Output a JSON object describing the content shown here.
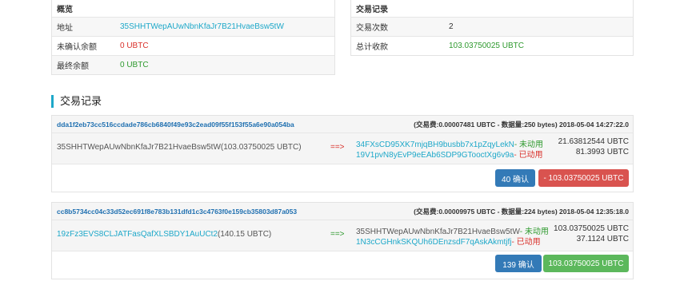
{
  "overview": {
    "title": "概览",
    "rows": [
      {
        "label": "地址",
        "value": "35SHHTWepAUwNbnKfaJr7B21HvaeBsw5tW"
      },
      {
        "label": "未确认余额",
        "value": "0 UBTC"
      },
      {
        "label": "最终余额",
        "value": "0 UBTC"
      }
    ]
  },
  "summary": {
    "title": "交易记录",
    "rows": [
      {
        "label": "交易次数",
        "value": "2"
      },
      {
        "label": "总计收款",
        "value": "103.03750025 UBTC"
      }
    ]
  },
  "section_title": "交易记录",
  "transactions": [
    {
      "txid": "dda1f2eb73cc516ccdade786cb6840f49e93c2ead09f55f153f55a6e90a054ba",
      "fee": "(交易费:0.00007481 UBTC - 数据量:250 bytes) 2018-05-04 14:27:22.0",
      "input": "35SHHTWepAUwNbnKfaJr7B21HvaeBsw5tW",
      "input_amount": "(103.03750025 UBTC)",
      "arrow": "==>",
      "arrow_color": "#d9312b",
      "outputs": [
        {
          "address": "34FXsCD95XK7mjqBH9busbb7x1pZqyLekN",
          "status": "- 未动用",
          "amount": "21.63812544 UBTC"
        },
        {
          "address": "19V1pvN8yEvP9eEAb6SDP9GTooctXg6v9a",
          "status": "- 已动用",
          "amount": "81.3993 UBTC"
        }
      ],
      "confirm_label": "40 确认",
      "total_label": "- 103.03750025 UBTC"
    },
    {
      "txid": "cc8b5734cc04c33d52ec691f8e783b131dfd1c3c4763f0e159cb35803d87a053",
      "fee": "(交易费:0.00009975 UBTC - 数据量:224 bytes) 2018-05-04 12:35:18.0",
      "input": "19zFz3EVS8CLJATFasQafXLSBDY1AuUCt2",
      "input_amount": "(140.15 UBTC)",
      "arrow": "==>",
      "arrow_color": "#2f9a2f",
      "outputs": [
        {
          "address": "35SHHTWepAUwNbnKfaJr7B21HvaeBsw5tW",
          "status": "- 未动用",
          "amount": "103.03750025 UBTC"
        },
        {
          "address": "1N3cCGHnkSKQUh6DEnzsdF7qAskAkmtjfj",
          "status": "- 已动用",
          "amount": "37.1124 UBTC"
        }
      ],
      "confirm_label": "139 确认",
      "total_label": "103.03750025 UBTC"
    }
  ]
}
